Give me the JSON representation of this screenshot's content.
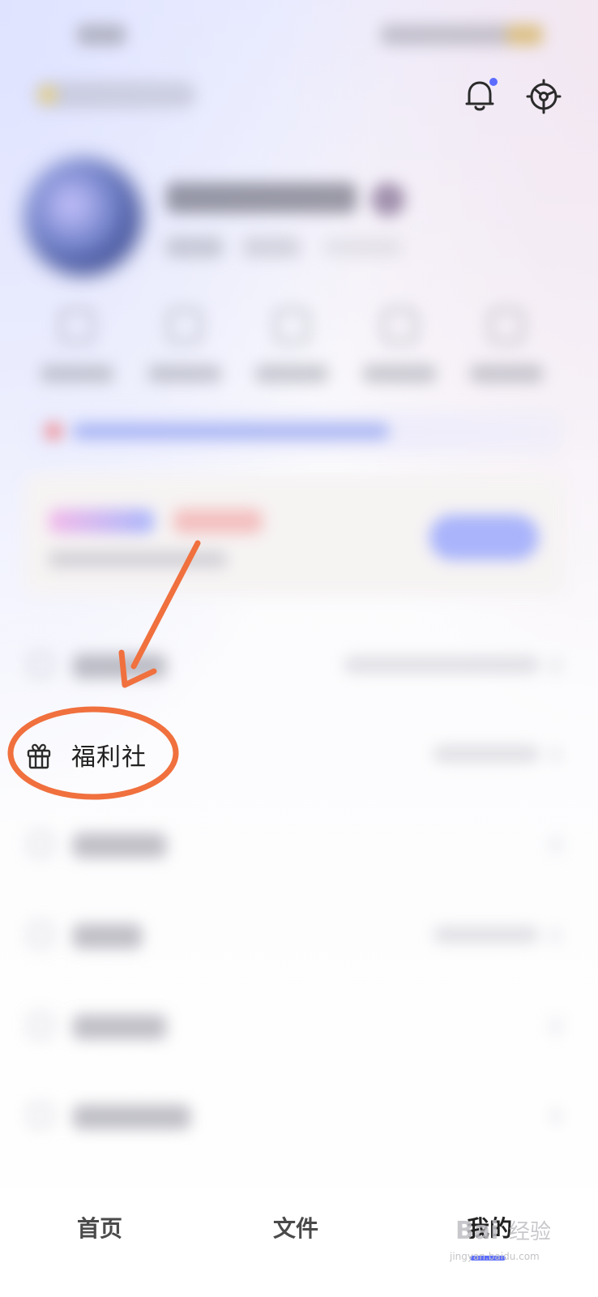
{
  "menu": {
    "welfare_label": "福利社"
  },
  "tabs": [
    {
      "label": "首页"
    },
    {
      "label": "文件"
    },
    {
      "label": "我的"
    }
  ],
  "watermark": {
    "text": "jingyan.baidu.com",
    "brand": "Bai 经验"
  },
  "colors": {
    "accent": "#5c6cff",
    "annotation": "#f0703e"
  },
  "icons": {
    "notification": "bell-icon",
    "settings": "gear-icon",
    "welfare": "gift-icon"
  }
}
